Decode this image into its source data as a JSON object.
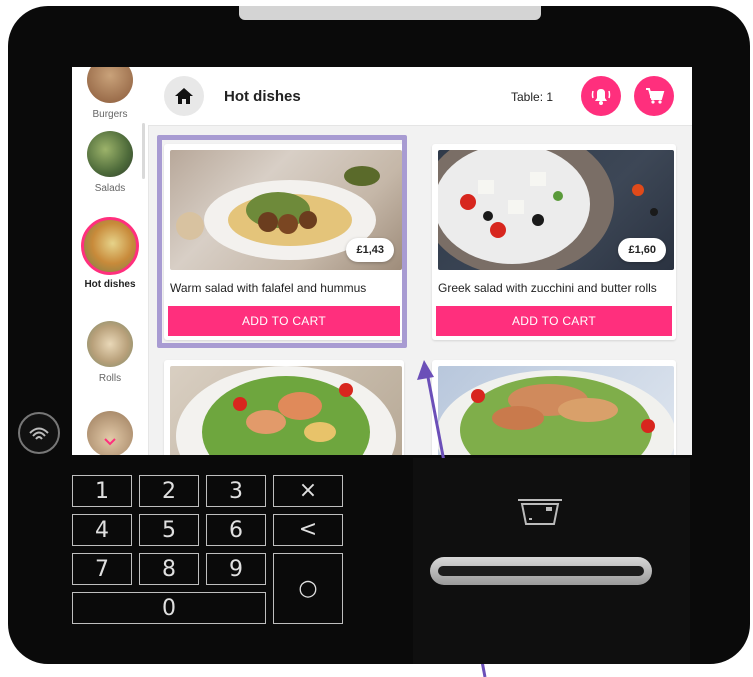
{
  "categories": [
    {
      "label": "Burgers"
    },
    {
      "label": "Salads"
    },
    {
      "label": "Hot dishes",
      "active": true
    },
    {
      "label": "Rolls"
    }
  ],
  "header": {
    "title": "Hot dishes",
    "table_label": "Table: 1"
  },
  "products": [
    {
      "name": "Warm salad with falafel and hummus",
      "price": "£1,43",
      "button": "ADD TO CART"
    },
    {
      "name": "Greek salad with zucchini and butter rolls",
      "price": "£1,60",
      "button": "ADD TO CART"
    }
  ],
  "keypad": {
    "digits": [
      "1",
      "2",
      "3",
      "4",
      "5",
      "6",
      "7",
      "8",
      "9",
      "0"
    ],
    "clear": "×",
    "back": "<",
    "enter": "○"
  },
  "colors": {
    "accent": "#ff2f7d",
    "highlight": "#a89bd2",
    "arrow": "#6b4fb8",
    "device": "#0a0a0a"
  },
  "icons": {
    "home": "home-icon",
    "bell": "bell-icon",
    "cart": "cart-icon",
    "nfc": "nfc-icon",
    "card": "card-icon"
  }
}
